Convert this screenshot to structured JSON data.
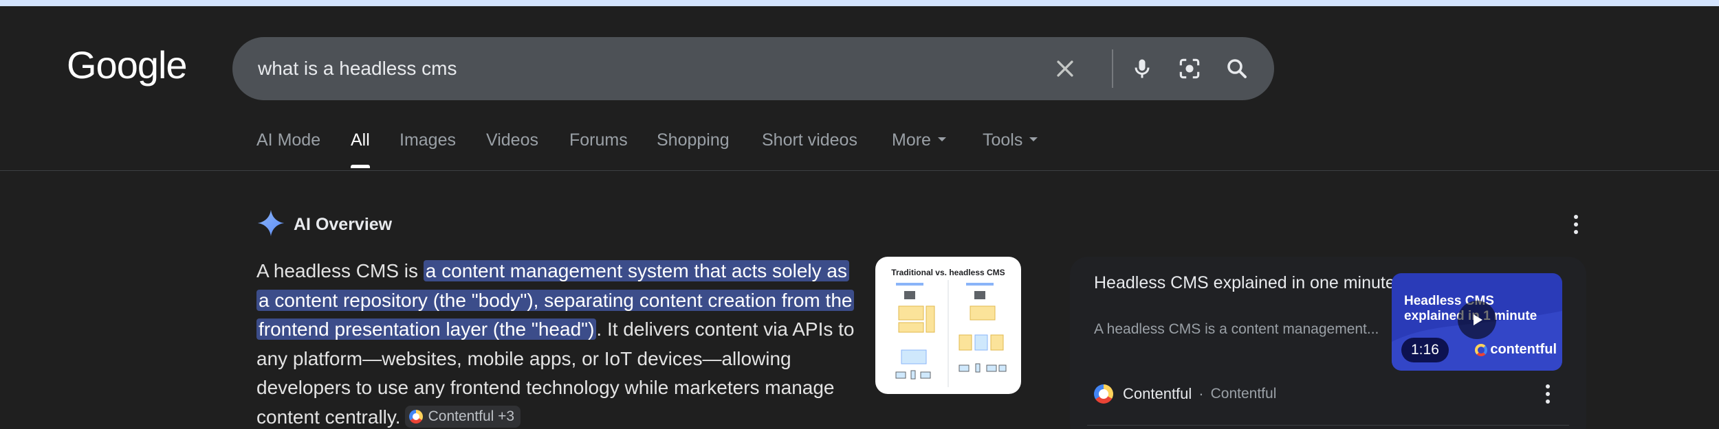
{
  "logo": {
    "text": "Google"
  },
  "search": {
    "query": "what is a headless cms",
    "clear_icon": "close-icon",
    "voice_icon": "mic-icon",
    "lens_icon": "camera-icon",
    "search_icon": "search-icon"
  },
  "tabs": [
    {
      "label": "AI Mode",
      "active": false
    },
    {
      "label": "All",
      "active": true
    },
    {
      "label": "Images",
      "active": false
    },
    {
      "label": "Videos",
      "active": false
    },
    {
      "label": "Forums",
      "active": false
    },
    {
      "label": "Shopping",
      "active": false
    },
    {
      "label": "Short videos",
      "active": false
    },
    {
      "label": "More",
      "active": false
    },
    {
      "label": "Tools",
      "active": false
    }
  ],
  "ai_overview": {
    "title": "AI Overview",
    "icon": "sparkle-icon",
    "text_before": "A headless CMS is ",
    "text_highlight": "a content management system that acts solely as a content repository (the \"body\"), separating content creation from the frontend presentation layer (the \"head\")",
    "text_after": ". It delivers content via APIs to any platform—websites, mobile apps, or IoT devices—allowing developers to use any frontend technology while marketers manage content centrally.",
    "source_chip": "Contentful +3",
    "thumbnail_title": "Traditional vs. headless CMS"
  },
  "video_card": {
    "title": "Headless CMS explained in one minute",
    "snippet": "A headless CMS is a content management...",
    "thumb_text": "Headless CMS explained in 1 minute",
    "duration": "1:16",
    "brand": "contentful",
    "source_name": "Contentful",
    "source_separator": "·",
    "source_sub": "Contentful"
  },
  "colors": {
    "background": "#1f1f1f",
    "highlight": "#3c4d8a",
    "search_bar": "#4d5156",
    "video_thumb": "#2a3bb8"
  }
}
